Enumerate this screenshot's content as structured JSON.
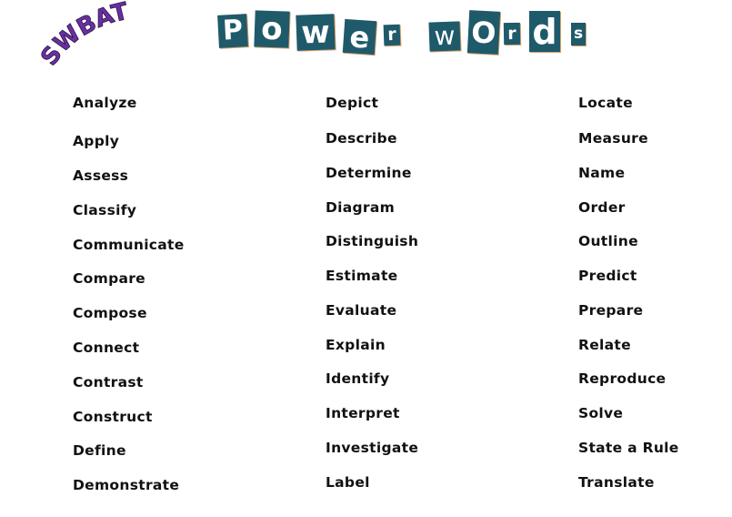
{
  "header": {
    "swbat_label": "SWBAT",
    "swbat_color": "#6a2fa0",
    "title_word_1": [
      "P",
      "o",
      "w",
      "e",
      "r"
    ],
    "title_word_2": [
      "w",
      "O",
      "r",
      "d",
      "s"
    ],
    "tile_color": "#1f5a6b"
  },
  "columns": [
    {
      "words": [
        "Analyze",
        "Apply",
        "Assess",
        "Classify",
        "Communicate",
        "Compare",
        "Compose",
        "Connect",
        "Contrast",
        "Construct",
        "Define",
        "Demonstrate"
      ]
    },
    {
      "words": [
        "Depict",
        "Describe",
        "Determine",
        "Diagram",
        "Distinguish",
        "Estimate",
        "Evaluate",
        "Explain",
        "Identify",
        "Interpret",
        "Investigate",
        "Label"
      ]
    },
    {
      "words": [
        "Locate",
        "Measure",
        "Name",
        "Order",
        "Outline",
        "Predict",
        "Prepare",
        "Relate",
        "Reproduce",
        "Solve",
        "State a Rule",
        "Translate"
      ]
    }
  ]
}
